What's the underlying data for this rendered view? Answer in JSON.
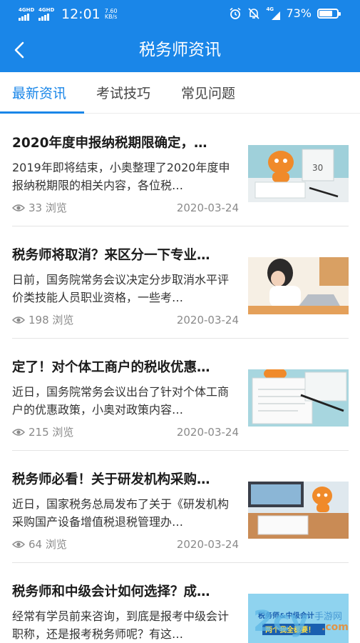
{
  "status_bar": {
    "network_1": "4GHD",
    "network_2": "4GHD",
    "time": "12:01",
    "speed_value": "7.60",
    "speed_unit": "KB/s",
    "network_3": "4G",
    "battery": "73%",
    "battery_level": 0.73
  },
  "header": {
    "title": "税务师资讯",
    "back_icon": "chevron-left-icon"
  },
  "tabs": [
    {
      "label": "最新资讯",
      "active": true
    },
    {
      "label": "考试技巧",
      "active": false
    },
    {
      "label": "常见问题",
      "active": false
    }
  ],
  "articles": [
    {
      "title": "2020年度申报纳税期限确定，…",
      "summary": "2019年即将结束，小奥整理了2020年度申报纳税期限的相关内容，各位税…",
      "views": "33 浏览",
      "date": "2020-03-24",
      "thumbnail": "mascot-calendar-notebook"
    },
    {
      "title": "税务师将取消？来区分一下专业…",
      "summary": "日前，国务院常务会议决定分步取消水平评价类技能人员职业资格，一些考…",
      "views": "198 浏览",
      "date": "2020-03-24",
      "thumbnail": "woman-laptop"
    },
    {
      "title": "定了！对个体工商户的税收优惠…",
      "summary": "近日，国务院常务会议出台了针对个体工商户的优惠政策，小奥对政策内容…",
      "views": "215 浏览",
      "date": "2020-03-24",
      "thumbnail": "notebook-pen"
    },
    {
      "title": "税务师必看！关于研发机构采购…",
      "summary": "近日，国家税务总局发布了关于《研发机构采购国产设备增值税退税管理办…",
      "views": "64 浏览",
      "date": "2020-03-24",
      "thumbnail": "mascot-desk-monitor"
    },
    {
      "title": "税务师和中级会计如何选择？成…",
      "summary": "经常有学员前来咨询，到底是报考中级会计职称，还是报考税务师呢？有这…",
      "views": "",
      "date": "",
      "thumbnail": "promo-banner",
      "thumbnail_text_1": "税务师&中级会计",
      "thumbnail_text_2": "两个我全都要！"
    }
  ],
  "watermark": {
    "text_1": "2cy",
    "text_2": "手游网",
    "text_3": ".com"
  },
  "colors": {
    "primary": "#1a86e8",
    "title_text": "#1b1b1b",
    "meta_text": "#8a8a8a"
  }
}
